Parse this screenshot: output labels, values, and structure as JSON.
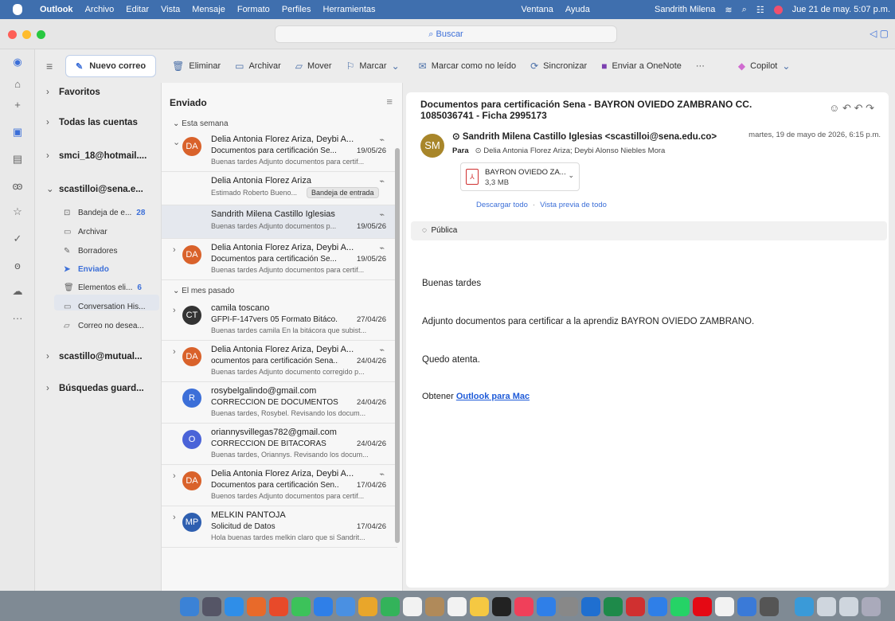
{
  "menubar": {
    "app": "Outlook",
    "items": [
      "Archivo",
      "Editar",
      "Vista",
      "Mensaje",
      "Formato",
      "Perfiles",
      "Herramientas"
    ],
    "window_items": [
      "Ventana",
      "Ayuda"
    ],
    "user": "Sandrith Milena",
    "datetime": "Jue 21 de may.  5:07 p.m."
  },
  "search": {
    "label": "Buscar"
  },
  "toolbar": {
    "new_mail": "Nuevo correo",
    "delete": "Eliminar",
    "archive": "Archivar",
    "move": "Mover",
    "flag": "Marcar",
    "mark_unread": "Marcar como no leído",
    "sync": "Sincronizar",
    "onenote": "Enviar a OneNote",
    "more": "···",
    "copilot": "Copilot"
  },
  "folders": {
    "favoritos": "Favoritos",
    "todas": "Todas las cuentas",
    "hotmail": "smci_18@hotmail....",
    "sena": "scastilloi@sena.e...",
    "items": [
      {
        "label": "Bandeja de e...",
        "count": "28"
      },
      {
        "label": "Archivar",
        "count": ""
      },
      {
        "label": "Borradores",
        "count": ""
      },
      {
        "label": "Enviado",
        "count": ""
      },
      {
        "label": "Elementos eli...",
        "count": "6"
      },
      {
        "label": "Conversation His...",
        "count": ""
      },
      {
        "label": "Correo no desea...",
        "count": ""
      }
    ],
    "mutual": "scastillo@mutual...",
    "busquedas": "Búsquedas guard..."
  },
  "list": {
    "title": "Enviado",
    "group_week": "Esta semana",
    "group_month": "El mes pasado",
    "messages": [
      {
        "initials": "DA",
        "from": "Delia Antonia Florez Ariza, Deybi A...",
        "subject": "Documentos para certificación Se...",
        "date": "19/05/26",
        "preview": "Buenas tardes Adjunto documentos para certif..."
      },
      {
        "initials": "",
        "from": "Delia Antonia Florez Ariza",
        "subject": "",
        "date": "",
        "preview": "Estimado Roberto Bueno...",
        "badge": "Bandeja de entrada"
      },
      {
        "initials": "",
        "from": "Sandrith Milena Castillo Iglesias",
        "subject": "",
        "date": "19/05/26",
        "preview": "Buenas tardes Adjunto documentos p..."
      },
      {
        "initials": "DA",
        "from": "Delia Antonia Florez Ariza, Deybi A...",
        "subject": "Documentos para certificación Se...",
        "date": "19/05/26",
        "preview": "Buenas tardes Adjunto documentos para certif..."
      },
      {
        "initials": "CT",
        "from": "camila toscano",
        "subject": "GFPI-F-147vers 05 Formato Bitáco...",
        "date": "27/04/26",
        "preview": "Buenas tardes camila En la bitácora que subist..."
      },
      {
        "initials": "DA",
        "from": "Delia Antonia Florez Ariza, Deybi A...",
        "subject": "ocumentos para certificación Sena...",
        "date": "24/04/26",
        "preview": "Buenas tardes Adjunto documento corregido p..."
      },
      {
        "initials": "R",
        "from": "rosybelgalindo@gmail.com",
        "subject": "CORRECCION DE DOCUMENTOS",
        "date": "24/04/26",
        "preview": "Buenas tardes, Rosybel. Revisando los docum..."
      },
      {
        "initials": "O",
        "from": "oriannysvillegas782@gmail.com",
        "subject": "CORRECCION DE BITACORAS",
        "date": "24/04/26",
        "preview": "Buenas tardes, Oriannys. Revisando los docum..."
      },
      {
        "initials": "DA",
        "from": "Delia Antonia Florez Ariza, Deybi A...",
        "subject": "Documentos para certificación Sen...",
        "date": "17/04/26",
        "preview": "Buenos tardes Adjunto documentos para certif..."
      },
      {
        "initials": "MP",
        "from": "MELKIN PANTOJA",
        "subject": "Solicitud de Datos",
        "date": "17/04/26",
        "preview": "Hola buenas tardes melkin claro que si Sandrit..."
      }
    ]
  },
  "reading": {
    "subject": "Documentos para certificación Sena - BAYRON OVIEDO ZAMBRANO CC. 1085036741 - Ficha 2995173",
    "avatar": "SM",
    "from": "Sandrith Milena Castillo Iglesias <scastilloi@sena.edu.co>",
    "date": "martes, 19 de mayo de 2026, 6:15 p.m.",
    "to_label": "Para",
    "to": "Delia Antonia Florez Ariza;  Deybi Alonso Niebles Mora",
    "attachment": {
      "name": "BAYRON OVIEDO ZA...",
      "size": "3,3 MB",
      "type": "PDF"
    },
    "download_all": "Descargar todo",
    "preview_all": "Vista previa de todo",
    "visibility": "Pública",
    "body": [
      "Buenas tardes",
      "Adjunto documentos para certificar a la aprendiz BAYRON OVIEDO ZAMBRANO.",
      "Quedo atenta."
    ],
    "footer_prefix": "Obtener",
    "footer_link": "Outlook para Mac"
  },
  "colors": {
    "accent": "#3c6fd8",
    "menubar": "#3f6fae",
    "avatar_da": "#d9622b",
    "avatar_ct": "#333333",
    "avatar_r": "#3c6fd8",
    "avatar_o": "#4a63d8",
    "avatar_mp": "#2e5fb0",
    "avatar_sm": "#a8862a"
  }
}
